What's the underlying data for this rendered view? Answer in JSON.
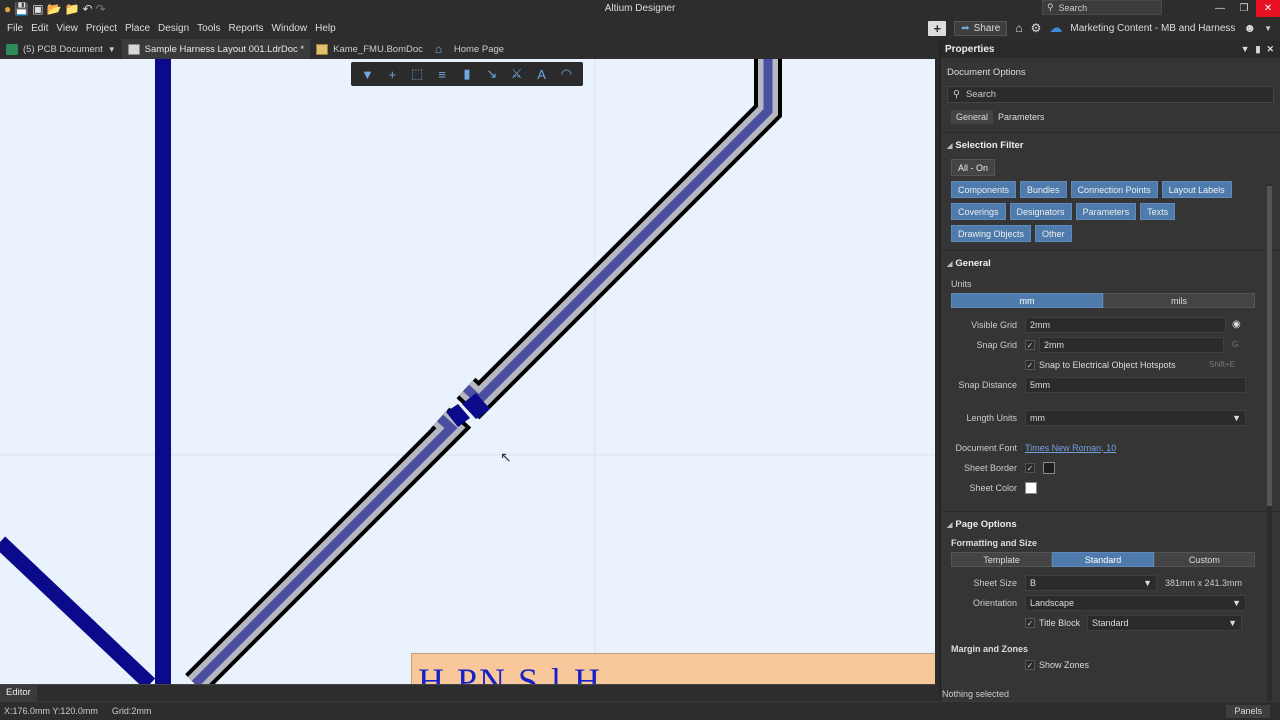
{
  "window": {
    "title": "Altium Designer",
    "search_placeholder": "Search",
    "quick_icons": [
      "app-logo",
      "save-icon",
      "save-all-icon",
      "open-icon",
      "open-project-icon",
      "undo-icon",
      "redo-icon"
    ],
    "controls": [
      "minimize",
      "restore",
      "close"
    ]
  },
  "menu": {
    "items": [
      "File",
      "Edit",
      "View",
      "Project",
      "Place",
      "Design",
      "Tools",
      "Reports",
      "Window",
      "Help"
    ],
    "share_label": "Share",
    "workspace": "Marketing Content - MB and Harness"
  },
  "tabs": [
    {
      "label": "(5) PCB Document",
      "icon": "pcb-icon",
      "active": false
    },
    {
      "label": "Sample Harness Layout 001.LdrDoc *",
      "icon": "document-icon",
      "active": true
    },
    {
      "label": "Kame_FMU.BomDoc",
      "icon": "bom-icon",
      "active": false
    },
    {
      "label": "Home Page",
      "icon": "home-icon",
      "active": false
    }
  ],
  "toolbar": {
    "tools": [
      "filter-icon",
      "crosshair-icon",
      "select-rect-icon",
      "align-icon",
      "component-icon",
      "wire-icon",
      "connector-icon",
      "text-icon",
      "arc-icon"
    ]
  },
  "canvas": {
    "title_block_text": "H     PN  S    l  H"
  },
  "editor": {
    "tab_label": "Editor"
  },
  "status": {
    "coords": "X:176.0mm Y:120.0mm",
    "grid": "Grid:2mm",
    "panels_label": "Panels",
    "selection": "Nothing selected"
  },
  "properties": {
    "panel_title": "Properties",
    "doc_options": "Document Options",
    "search_placeholder": "Search",
    "tabs": [
      "General",
      "Parameters"
    ],
    "selection_filter": {
      "title": "Selection Filter",
      "all_on": "All - On",
      "chips": [
        "Components",
        "Bundles",
        "Connection Points",
        "Layout Labels",
        "Coverings",
        "Designators",
        "Parameters",
        "Texts",
        "Drawing Objects",
        "Other"
      ]
    },
    "general": {
      "title": "General",
      "units_label": "Units",
      "units": [
        "mm",
        "mils"
      ],
      "visible_grid_label": "Visible Grid",
      "visible_grid": "2mm",
      "snap_grid_label": "Snap Grid",
      "snap_grid": "2mm",
      "snap_key": "G",
      "snap_hotspots_label": "Snap to Electrical Object Hotspots",
      "snap_hotspots_key": "Shift+E",
      "snap_distance_label": "Snap Distance",
      "snap_distance": "5mm",
      "length_units_label": "Length Units",
      "length_units": "mm",
      "document_font_label": "Document Font",
      "document_font": "Times New Roman, 10",
      "sheet_border_label": "Sheet Border",
      "sheet_color_label": "Sheet Color",
      "sheet_border_color": "#1e1e1e",
      "sheet_color": "#ffffff"
    },
    "page_options": {
      "title": "Page Options",
      "formatting_label": "Formatting and Size",
      "formatting": [
        "Template",
        "Standard",
        "Custom"
      ],
      "sheet_size_label": "Sheet Size",
      "sheet_size": "B",
      "sheet_dims": "381mm x 241.3mm",
      "orientation_label": "Orientation",
      "orientation": "Landscape",
      "title_block_label": "Title Block",
      "title_block": "Standard",
      "margin_zones_label": "Margin and Zones",
      "show_zones_label": "Show Zones"
    }
  },
  "colors": {
    "canvas_bg": "#eaf2fd",
    "harness_fill": "#4a4fa0",
    "harness_stripe": "#b7b7c2",
    "wire": "#0a0a8a",
    "accent_blue": "#4e7bab"
  }
}
